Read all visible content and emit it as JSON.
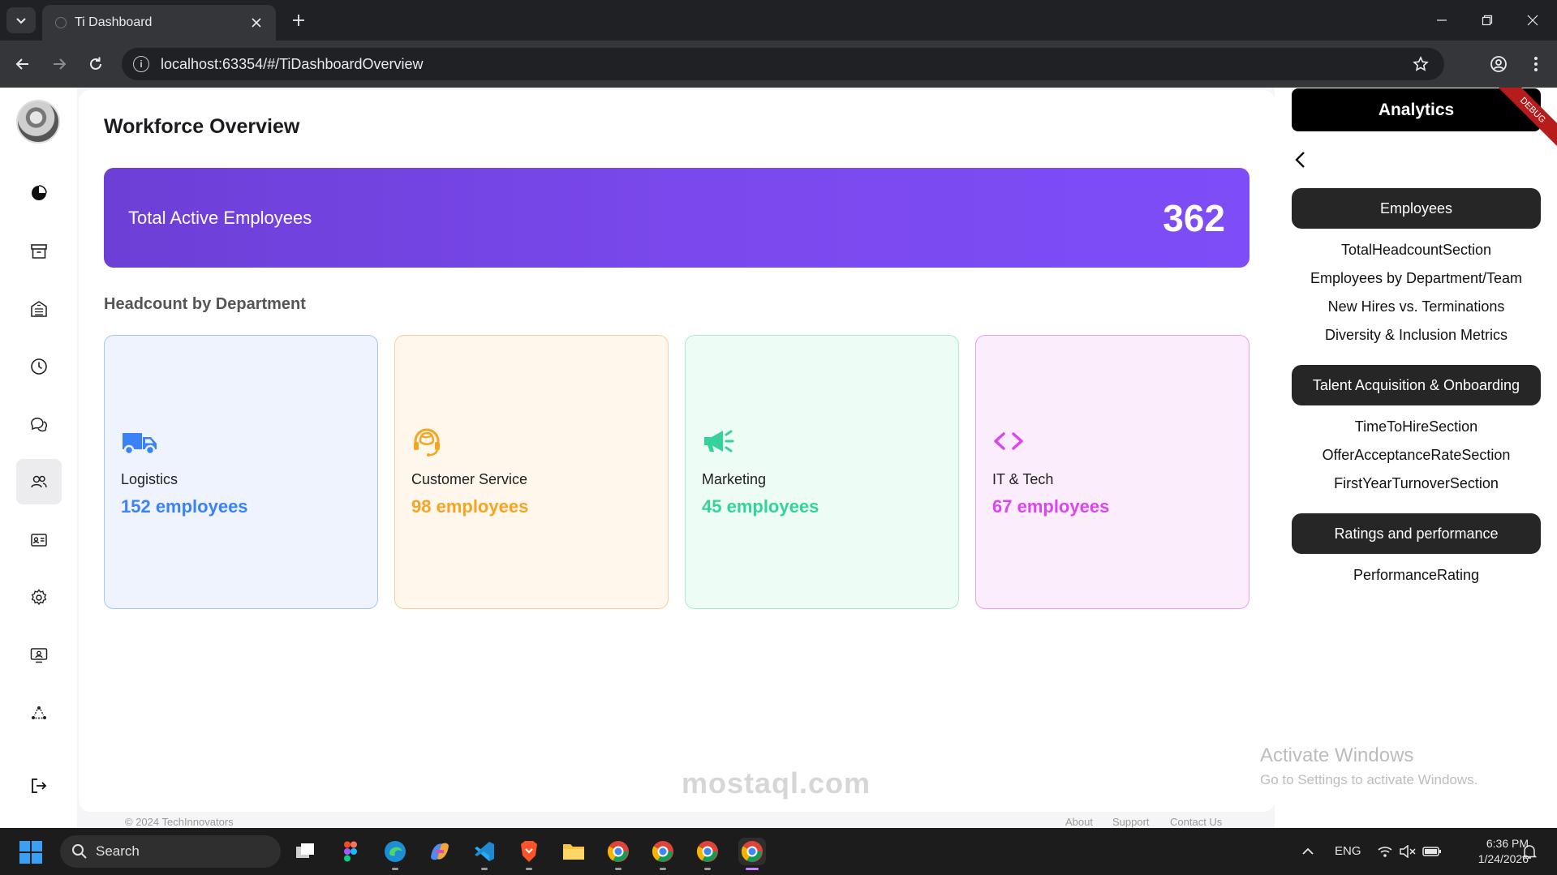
{
  "browser": {
    "tab_title": "Ti Dashboard",
    "url": "localhost:63354/#/TiDashboardOverview"
  },
  "main": {
    "title": "Workforce Overview",
    "total": {
      "label": "Total Active Employees",
      "value": "362"
    },
    "section_title": "Headcount by Department",
    "departments": [
      {
        "name": "Logistics",
        "count": "152 employees",
        "color": "#3b82f6",
        "bg": "#eef3fd",
        "border": "#a9c4f7",
        "icon": "truck-icon"
      },
      {
        "name": "Customer Service",
        "count": "98 employees",
        "color": "#f5a524",
        "bg": "#fff6ec",
        "border": "#f8cf9a",
        "icon": "headset-icon"
      },
      {
        "name": "Marketing",
        "count": "45 employees",
        "color": "#34d399",
        "bg": "#eefcf6",
        "border": "#a7ecd0",
        "icon": "megaphone-icon"
      },
      {
        "name": "IT & Tech",
        "count": "67 employees",
        "color": "#d946ef",
        "bg": "#fcedfc",
        "border": "#ef9cf3",
        "icon": "code-icon"
      }
    ]
  },
  "footer": {
    "copyright": "© 2024 TechInnovators",
    "links": [
      "About",
      "Support",
      "Contact Us"
    ]
  },
  "panel": {
    "title": "Analytics",
    "debug_label": "DEBUG",
    "sections": [
      {
        "label": "Employees",
        "items": [
          "TotalHeadcountSection",
          "Employees by Department/Team",
          "New Hires vs. Terminations",
          "Diversity & Inclusion Metrics"
        ]
      },
      {
        "label": "Talent Acquisition & Onboarding",
        "items": [
          "TimeToHireSection",
          "OfferAcceptanceRateSection",
          "FirstYearTurnoverSection"
        ]
      },
      {
        "label": "Ratings and performance",
        "items": [
          "PerformanceRating"
        ]
      }
    ]
  },
  "watermark": {
    "title": "Activate Windows",
    "subtitle": "Go to Settings to activate Windows.",
    "brand": "mostaql.com"
  },
  "taskbar": {
    "search_label": "Search",
    "language": "ENG",
    "time": "6:36 PM",
    "date": "1/24/2026"
  }
}
